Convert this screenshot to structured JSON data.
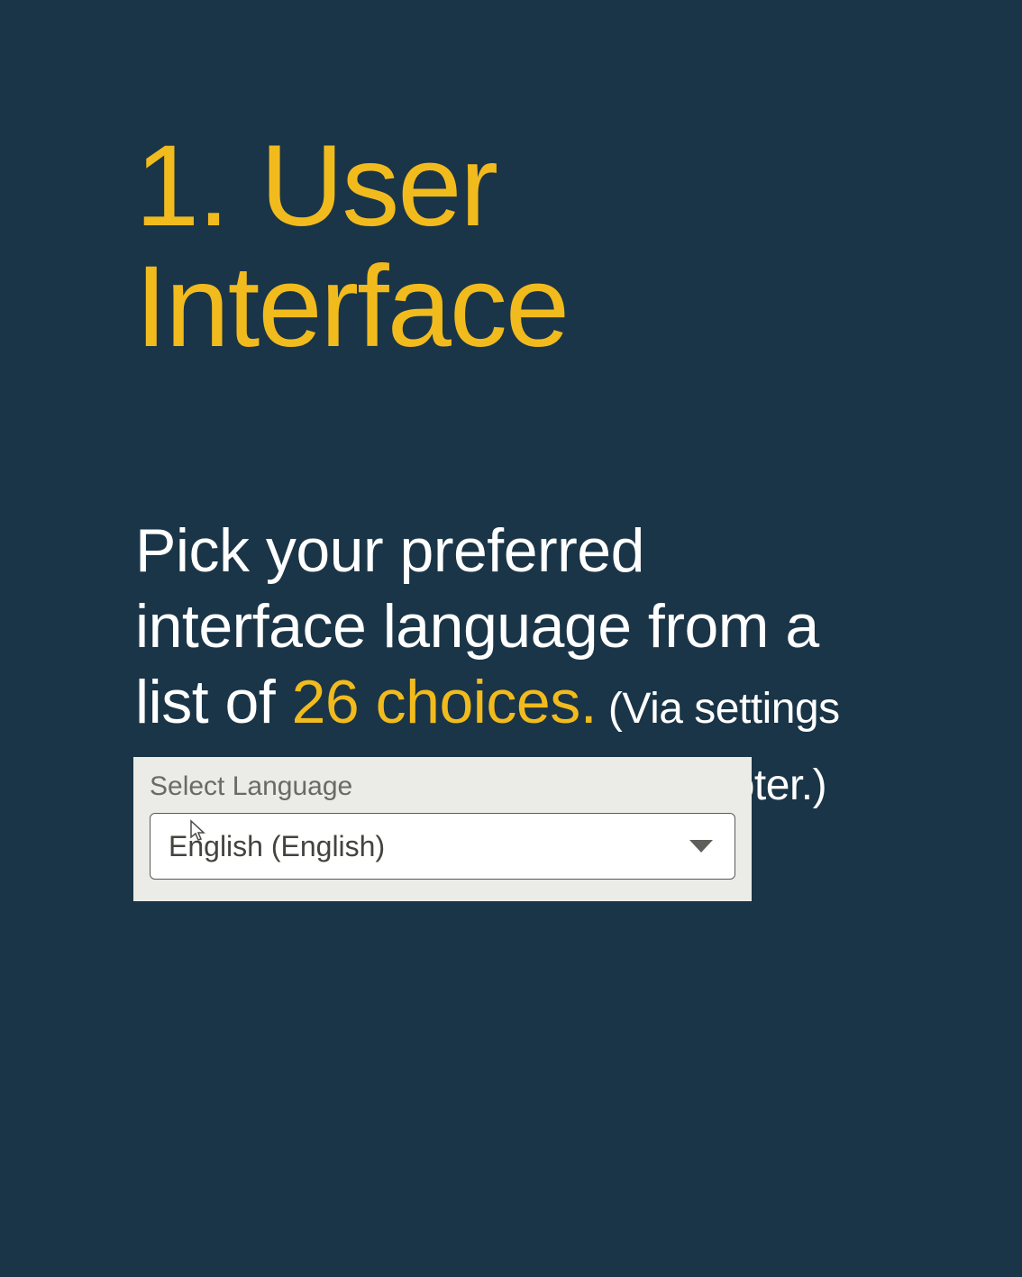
{
  "title": {
    "number": "1.",
    "text": "User Interface"
  },
  "description": {
    "lead": "Pick your preferred interface language from a list of ",
    "accent": "26 choices.",
    "small": " (Via settings or via the dropdown list in the footer.)"
  },
  "dropdown": {
    "label": "Select Language",
    "selected": "English (English)"
  }
}
